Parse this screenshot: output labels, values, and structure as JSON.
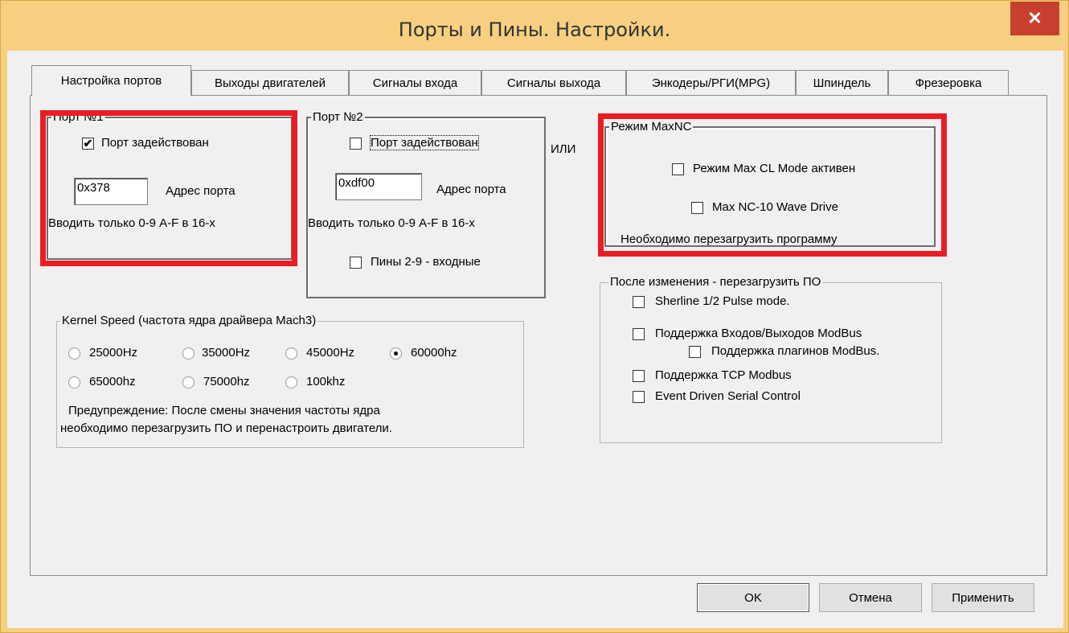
{
  "window": {
    "title": "Порты и Пины.  Настройки.",
    "close_label": "✕"
  },
  "tabs": [
    "Настройка портов",
    "Выходы двигателей",
    "Сигналы входа",
    "Сигналы выхода",
    "Энкодеры/РГИ(MPG)",
    "Шпиндель",
    "Фрезеровка"
  ],
  "port1": {
    "legend": "Порт №1",
    "enabled_label": "Порт задействован",
    "enabled": true,
    "address_value": "0x378",
    "address_label": "Адрес порта",
    "hint": "Вводить только 0-9 A-F в 16-х"
  },
  "port2": {
    "legend": "Порт №2",
    "enabled_label": "Порт задействован",
    "enabled": false,
    "address_value": "0xdf00",
    "address_label": "Адрес порта",
    "hint": "Вводить только 0-9 A-F в 16-х",
    "pins_input_label": "Пины 2-9 - входные"
  },
  "or_label": "ИЛИ",
  "maxnc": {
    "legend": "Режим MaxNC",
    "cl_mode_label": "Режим Max CL Mode активен",
    "wave_drive_label": "Max NC-10 Wave Drive",
    "restart_note": "Необходимо перезагрузить программу"
  },
  "after_change": {
    "legend": "После изменения - перезагрузить ПО",
    "options": [
      "Sherline 1/2 Pulse mode.",
      "Поддержка Входов/Выходов ModBus",
      "Поддержка плагинов ModBus.",
      "Поддержка TCP Modbus",
      "Event Driven Serial Control"
    ]
  },
  "kernel": {
    "legend": "Kernel Speed (частота ядра драйвера Mach3)",
    "options": [
      "25000Hz",
      "35000Hz",
      "45000Hz",
      "60000hz",
      "65000hz",
      "75000hz",
      "100khz"
    ],
    "selected": "60000hz",
    "warning_line1": "Предупреждение: После смены значения частоты ядра",
    "warning_line2": "необходимо перезагрузить ПО и перенастроить двигатели."
  },
  "buttons": {
    "ok": "OK",
    "cancel": "Отмена",
    "apply": "Применить"
  },
  "colors": {
    "highlight": "#ec1c24",
    "title_bg": "#f6cf80",
    "close_bg": "#c7402e"
  }
}
